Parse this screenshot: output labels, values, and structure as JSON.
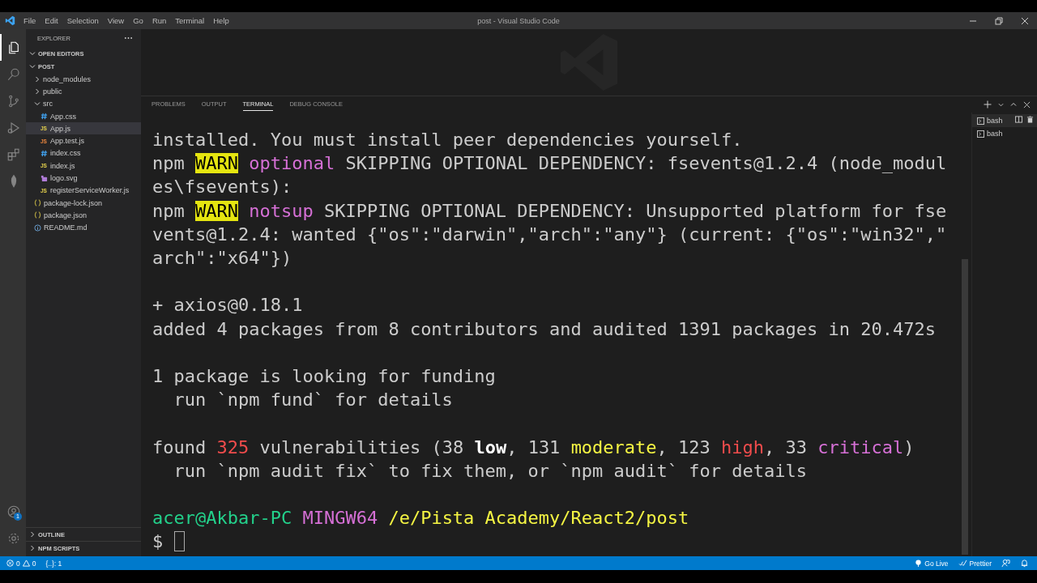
{
  "window": {
    "title": "post - Visual Studio Code"
  },
  "menu": [
    "File",
    "Edit",
    "Selection",
    "View",
    "Go",
    "Run",
    "Terminal",
    "Help"
  ],
  "activity_bar": {
    "items": [
      {
        "kind": "files",
        "selected": true
      },
      {
        "kind": "search",
        "selected": false
      },
      {
        "kind": "source-control",
        "selected": false
      },
      {
        "kind": "run",
        "selected": false
      },
      {
        "kind": "extensions",
        "selected": false
      },
      {
        "kind": "leaf",
        "selected": false
      }
    ],
    "account_badge": "1"
  },
  "sidebar": {
    "title": "EXPLORER",
    "sections": [
      {
        "label": "OPEN EDITORS",
        "expanded": true
      },
      {
        "label": "POST",
        "expanded": true,
        "children": [
          {
            "label": "node_modules",
            "kind": "folder",
            "expanded": false,
            "selected": false
          },
          {
            "label": "public",
            "kind": "folder",
            "expanded": false,
            "selected": false
          },
          {
            "label": "src",
            "kind": "folder",
            "expanded": true,
            "selected": false,
            "children": [
              {
                "label": "App.css",
                "kind": "css",
                "selected": false
              },
              {
                "label": "App.js",
                "kind": "js",
                "icon_text": "JS",
                "selected": true
              },
              {
                "label": "App.test.js",
                "kind": "test",
                "icon_text": "JS",
                "selected": false
              },
              {
                "label": "index.css",
                "kind": "css",
                "selected": false
              },
              {
                "label": "index.js",
                "kind": "js",
                "icon_text": "JS",
                "selected": false
              },
              {
                "label": "logo.svg",
                "kind": "svg",
                "selected": false
              },
              {
                "label": "registerServiceWorker.js",
                "kind": "js",
                "icon_text": "JS",
                "selected": false
              }
            ]
          },
          {
            "label": "package-lock.json",
            "kind": "json",
            "selected": false
          },
          {
            "label": "package.json",
            "kind": "json",
            "selected": false
          },
          {
            "label": "README.md",
            "kind": "info",
            "selected": false
          }
        ]
      }
    ],
    "bottom_sections": [
      {
        "label": "OUTLINE",
        "expanded": false
      },
      {
        "label": "NPM SCRIPTS",
        "expanded": false
      }
    ]
  },
  "panel": {
    "tabs": [
      {
        "label": "PROBLEMS",
        "selected": false
      },
      {
        "label": "OUTPUT",
        "selected": false
      },
      {
        "label": "TERMINAL",
        "selected": true
      },
      {
        "label": "DEBUG CONSOLE",
        "selected": false
      }
    ],
    "terminals": [
      {
        "label": "bash",
        "selected": true
      },
      {
        "label": "bash",
        "selected": false
      }
    ],
    "lines": [
      {
        "kind": "text",
        "segments": [
          {
            "kind": "plain",
            "text": "installed. You must install peer dependencies yourself."
          }
        ]
      },
      {
        "kind": "text",
        "segments": [
          {
            "kind": "plain",
            "text": "npm "
          },
          {
            "kind": "warn",
            "text": "WARN"
          },
          {
            "kind": "magenta",
            "text": " optional"
          },
          {
            "kind": "plain",
            "text": " SKIPPING OPTIONAL DEPENDENCY: fsevents@1.2.4 (node_modul"
          }
        ]
      },
      {
        "kind": "text",
        "segments": [
          {
            "kind": "plain",
            "text": "es\\fsevents):"
          }
        ]
      },
      {
        "kind": "text",
        "segments": [
          {
            "kind": "plain",
            "text": "npm "
          },
          {
            "kind": "warn",
            "text": "WARN"
          },
          {
            "kind": "magenta",
            "text": " notsup"
          },
          {
            "kind": "plain",
            "text": " SKIPPING OPTIONAL DEPENDENCY: Unsupported platform for fse"
          }
        ]
      },
      {
        "kind": "text",
        "segments": [
          {
            "kind": "plain",
            "text": "vents@1.2.4: wanted {\"os\":\"darwin\",\"arch\":\"any\"} (current: {\"os\":\"win32\",\""
          }
        ]
      },
      {
        "kind": "text",
        "segments": [
          {
            "kind": "plain",
            "text": "arch\":\"x64\"})"
          }
        ]
      },
      {
        "kind": "blank"
      },
      {
        "kind": "text",
        "segments": [
          {
            "kind": "plain",
            "text": "+ axios@0.18.1"
          }
        ]
      },
      {
        "kind": "text",
        "segments": [
          {
            "kind": "plain",
            "text": "added 4 packages from 8 contributors and audited 1391 packages in 20.472s"
          }
        ]
      },
      {
        "kind": "blank"
      },
      {
        "kind": "text",
        "segments": [
          {
            "kind": "plain",
            "text": "1 package is looking for funding"
          }
        ]
      },
      {
        "kind": "text",
        "segments": [
          {
            "kind": "plain",
            "text": "  run `npm fund` for details"
          }
        ]
      },
      {
        "kind": "blank"
      },
      {
        "kind": "text",
        "segments": [
          {
            "kind": "plain",
            "text": "found "
          },
          {
            "kind": "red",
            "text": "325"
          },
          {
            "kind": "plain",
            "text": " vulnerabilities (38 "
          },
          {
            "kind": "bold",
            "text": "low"
          },
          {
            "kind": "plain",
            "text": ", 131 "
          },
          {
            "kind": "yellow",
            "text": "moderate"
          },
          {
            "kind": "plain",
            "text": ", 123 "
          },
          {
            "kind": "red",
            "text": "high"
          },
          {
            "kind": "plain",
            "text": ", 33 "
          },
          {
            "kind": "magenta",
            "text": "critical"
          },
          {
            "kind": "plain",
            "text": ")"
          }
        ]
      },
      {
        "kind": "text",
        "segments": [
          {
            "kind": "plain",
            "text": "  run `npm audit fix` to fix them, or `npm audit` for details"
          }
        ]
      },
      {
        "kind": "blank"
      },
      {
        "kind": "text",
        "segments": [
          {
            "kind": "green",
            "text": "acer@Akbar-PC"
          },
          {
            "kind": "magenta",
            "text": " MINGW64"
          },
          {
            "kind": "yellow",
            "text": " /e/Pista Academy/React2/post"
          }
        ]
      },
      {
        "kind": "prompt",
        "segments": [
          {
            "kind": "plain",
            "text": "$ "
          }
        ]
      }
    ]
  },
  "status_bar": {
    "errors": "0",
    "warnings": "0",
    "position": "{..}: 1",
    "right": [
      {
        "kind": "go-live",
        "label": "Go Live"
      },
      {
        "kind": "prettier",
        "label": "Prettier"
      },
      {
        "kind": "feedback"
      },
      {
        "kind": "bell"
      }
    ]
  }
}
